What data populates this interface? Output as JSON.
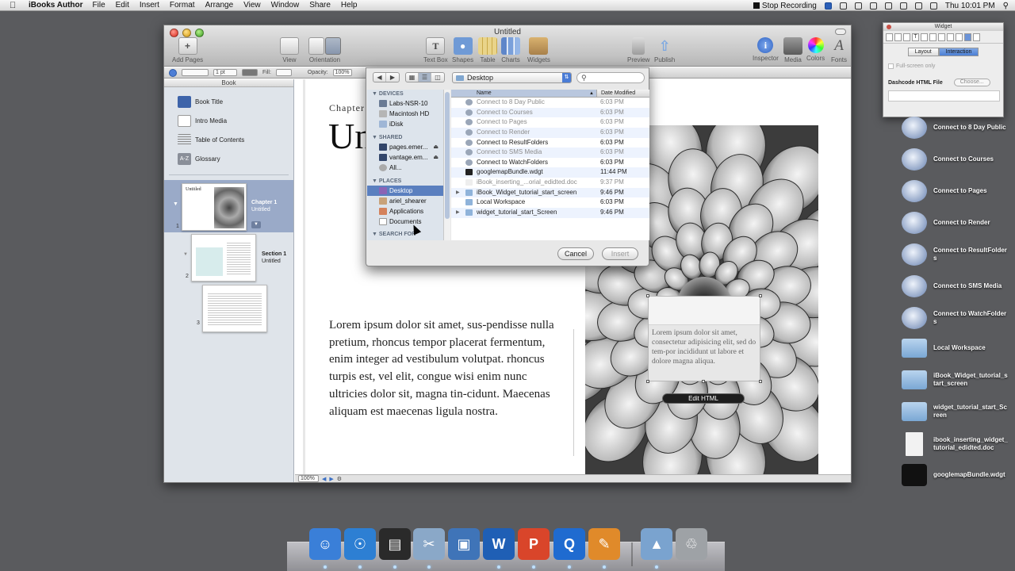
{
  "menubar": {
    "app_name": "iBooks Author",
    "menus": [
      "File",
      "Edit",
      "Insert",
      "Format",
      "Arrange",
      "View",
      "Window",
      "Share",
      "Help"
    ],
    "stop_recording": "Stop Recording",
    "clock": "Thu 10:01 PM"
  },
  "window": {
    "title": "Untitled",
    "toolbar": {
      "add_pages": "Add Pages",
      "view": "View",
      "orientation": "Orientation",
      "text_box": "Text Box",
      "shapes": "Shapes",
      "table": "Table",
      "charts": "Charts",
      "widgets": "Widgets",
      "preview": "Preview",
      "publish": "Publish",
      "inspector": "Inspector",
      "media": "Media",
      "colors": "Colors",
      "fonts": "Fonts"
    },
    "format_bar": {
      "stroke_width": "1 pt",
      "fill": "Fill:",
      "opacity_label": "Opacity:",
      "opacity_value": "100%"
    },
    "sidebar": {
      "header": "Book",
      "items": [
        "Book Title",
        "Intro Media",
        "Table of Contents",
        "Glossary"
      ],
      "glossary_icon_text": "A-Z",
      "chapter": {
        "label": "Chapter 1",
        "title": "Untitled",
        "page": "1",
        "thumb_title": "Untitled"
      },
      "section": {
        "label": "Section 1",
        "title": "Untitled",
        "page": "2"
      },
      "page3": "3"
    },
    "canvas": {
      "chapter_label": "Chapter",
      "title_fragment": "Un",
      "body_text": "Lorem ipsum dolor sit amet, sus-pendisse nulla pretium, rhoncus tempor placerat fermentum, enim integer ad vestibulum volutpat. rhoncus turpis est, vel elit, congue wisi enim nunc ultricies dolor sit, magna tin-cidunt. Maecenas aliquam est maecenas ligula nostra.",
      "widget_text": "Lorem ipsum dolor sit amet, consectetur adipisicing elit, sed do tem-por incididunt ut labore et dolore magna aliqua.",
      "edit_html": "Edit HTML",
      "zoom": "100%"
    }
  },
  "file_dialog": {
    "location": "Desktop",
    "columns": {
      "name": "Name",
      "date": "Date Modified"
    },
    "sidebar": {
      "devices_header": "DEVICES",
      "devices": [
        "Labs-NSR-10",
        "Macintosh HD",
        "iDisk"
      ],
      "shared_header": "SHARED",
      "shared": [
        "pages.emer...",
        "vantage.em...",
        "All..."
      ],
      "places_header": "PLACES",
      "places": [
        "Desktop",
        "ariel_shearer",
        "Applications",
        "Documents"
      ],
      "search_header": "SEARCH FOR"
    },
    "files": [
      {
        "name": "Connect to 8 Day Public",
        "date": "6:03 PM",
        "dim": true
      },
      {
        "name": "Connect to Courses",
        "date": "6:03 PM",
        "dim": true
      },
      {
        "name": "Connect to Pages",
        "date": "6:03 PM",
        "dim": true
      },
      {
        "name": "Connect to Render",
        "date": "6:03 PM",
        "dim": true
      },
      {
        "name": "Connect to ResultFolders",
        "date": "6:03 PM",
        "dim": false
      },
      {
        "name": "Connect to SMS Media",
        "date": "6:03 PM",
        "dim": true
      },
      {
        "name": "Connect to WatchFolders",
        "date": "6:03 PM",
        "dim": false
      },
      {
        "name": "googlemapBundle.wdgt",
        "date": "11:44 PM",
        "dim": false
      },
      {
        "name": "iBook_inserting_...orial_edidted.doc",
        "date": "9:37 PM",
        "dim": true
      },
      {
        "name": "iBook_Widget_tutorial_start_screen",
        "date": "9:46 PM",
        "dim": false
      },
      {
        "name": "Local Workspace",
        "date": "6:03 PM",
        "dim": false
      },
      {
        "name": "widget_tutorial_start_Screen",
        "date": "9:46 PM",
        "dim": false
      }
    ],
    "cancel": "Cancel",
    "insert": "Insert"
  },
  "inspector": {
    "title": "Widget",
    "tabs": [
      "Layout",
      "Interaction"
    ],
    "fullscreen_only": "Full-screen only",
    "dashcode_label": "Dashcode HTML File",
    "choose": "Choose..."
  },
  "desktop": [
    {
      "label": "Connect to 8 Day Public",
      "icon": "globe-icon"
    },
    {
      "label": "Connect to Courses",
      "icon": "globe-icon"
    },
    {
      "label": "Connect to Pages",
      "icon": "globe-icon"
    },
    {
      "label": "Connect to Render",
      "icon": "globe-icon"
    },
    {
      "label": "Connect to ResultFolders",
      "icon": "globe-icon"
    },
    {
      "label": "Connect to SMS Media",
      "icon": "globe-icon"
    },
    {
      "label": "Connect to WatchFolders",
      "icon": "globe-icon"
    },
    {
      "label": "Local Workspace",
      "icon": "folder-icon"
    },
    {
      "label": "iBook_Widget_tutorial_start_screen",
      "icon": "folder-icon"
    },
    {
      "label": "widget_tutorial_start_Screen",
      "icon": "folder-icon"
    },
    {
      "label": "ibook_inserting_widget_tutorial_edidted.doc",
      "icon": "doc-icon"
    },
    {
      "label": "googlemapBundle.wdgt",
      "icon": "widget-bundle-icon"
    }
  ],
  "dock": [
    {
      "name": "finder",
      "color": "#3a7fd8"
    },
    {
      "name": "safari",
      "color": "#2d7fd3"
    },
    {
      "name": "final-cut",
      "color": "#2a2a2a"
    },
    {
      "name": "screenflow",
      "color": "#8aa8c8"
    },
    {
      "name": "virtualbox",
      "color": "#3f74b8"
    },
    {
      "name": "word",
      "color": "#1f5fb5"
    },
    {
      "name": "powerpoint",
      "color": "#d9452a"
    },
    {
      "name": "quicktime",
      "color": "#1f6bd0"
    },
    {
      "name": "ibooks-author",
      "color": "#e08a2a"
    },
    {
      "name": "applications-stack",
      "color": "#7aa3cf"
    },
    {
      "name": "trash",
      "color": "#9ea2a6"
    }
  ]
}
